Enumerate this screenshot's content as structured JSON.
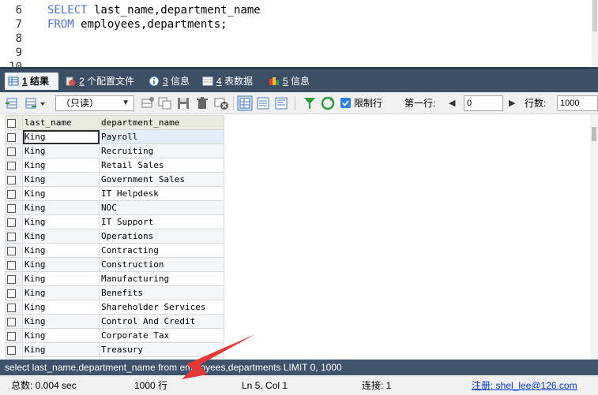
{
  "editor": {
    "lines": [
      {
        "num": "6",
        "kw": "SELECT",
        "rest": " last_name,department_name"
      },
      {
        "num": "7",
        "kw": "FROM",
        "rest": " employees,departments;"
      },
      {
        "num": "8",
        "kw": "",
        "rest": ""
      },
      {
        "num": "9",
        "kw": "",
        "rest": ""
      },
      {
        "num": "10",
        "kw": "",
        "rest": ""
      }
    ]
  },
  "tabs": [
    {
      "num": "1",
      "label": " 结果",
      "icon": "grid-result-icon",
      "active": true
    },
    {
      "num": "2",
      "label": " 个配置文件",
      "icon": "profile-icon",
      "active": false
    },
    {
      "num": "3",
      "label": " 信息",
      "icon": "info-icon",
      "active": false
    },
    {
      "num": "4",
      "label": " 表数据",
      "icon": "table-data-icon",
      "active": false
    },
    {
      "num": "5",
      "label": " 信息",
      "icon": "history-info-icon",
      "active": false
    }
  ],
  "toolbar": {
    "mode_select": "（只读）",
    "limit_label": "限制行",
    "first_row_label": "第一行:",
    "first_row_value": "0",
    "rows_label": "行数:",
    "rows_value": "1000"
  },
  "grid": {
    "columns": [
      "last_name",
      "department_name"
    ],
    "rows": [
      [
        "King",
        "Payroll"
      ],
      [
        "King",
        "Recruiting"
      ],
      [
        "King",
        "Retail Sales"
      ],
      [
        "King",
        "Government Sales"
      ],
      [
        "King",
        "IT Helpdesk"
      ],
      [
        "King",
        "NOC"
      ],
      [
        "King",
        "IT Support"
      ],
      [
        "King",
        "Operations"
      ],
      [
        "King",
        "Contracting"
      ],
      [
        "King",
        "Construction"
      ],
      [
        "King",
        "Manufacturing"
      ],
      [
        "King",
        "Benefits"
      ],
      [
        "King",
        "Shareholder Services"
      ],
      [
        "King",
        "Control And Credit"
      ],
      [
        "King",
        "Corporate Tax"
      ],
      [
        "King",
        "Treasury"
      ],
      [
        "",
        ""
      ]
    ]
  },
  "query_bar": "select last_name,department_name from employees,departments LIMIT 0, 1000",
  "status": {
    "total_time": "总数: 0.004 sec",
    "row_count": "1000 行",
    "cursor": "Ln 5, Col 1",
    "connection": "连接: 1",
    "registration": "注册:  shel_lee@126.com"
  },
  "colors": {
    "tabbar": "#3c4f64",
    "querybar": "#3f546c",
    "keyword": "#4a72d6",
    "arrow": "#e53935"
  }
}
